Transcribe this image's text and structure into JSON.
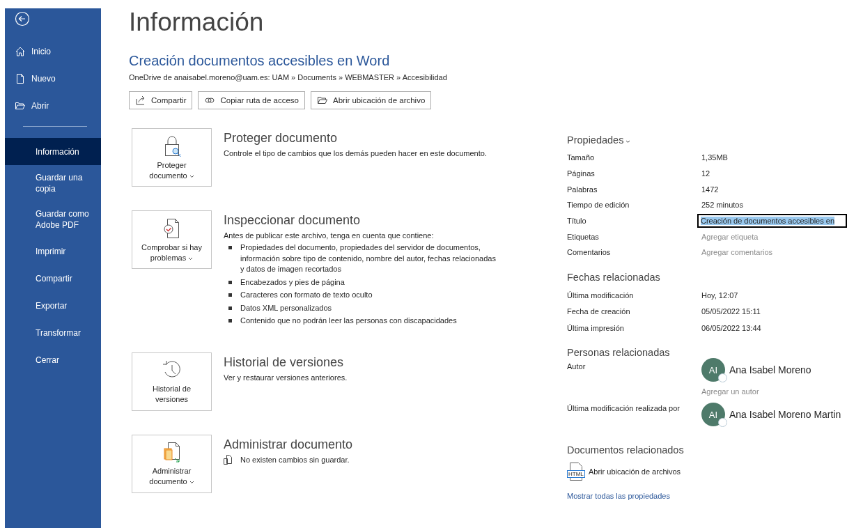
{
  "sidebar": {
    "items": [
      {
        "label": "Inicio",
        "kind": "icon",
        "selected": false
      },
      {
        "label": "Nuevo",
        "kind": "icon",
        "selected": false
      },
      {
        "label": "Abrir",
        "kind": "icon",
        "selected": false
      },
      {
        "kind": "divider"
      },
      {
        "label": "Información",
        "kind": "plain",
        "selected": true
      },
      {
        "label": "Guardar una copia",
        "kind": "plain",
        "selected": false
      },
      {
        "label": "Guardar como Adobe PDF",
        "kind": "plain",
        "selected": false
      },
      {
        "label": "Imprimir",
        "kind": "plain",
        "selected": false
      },
      {
        "label": "Compartir",
        "kind": "plain",
        "selected": false
      },
      {
        "label": "Exportar",
        "kind": "plain",
        "selected": false
      },
      {
        "label": "Transformar",
        "kind": "plain",
        "selected": false
      },
      {
        "label": "Cerrar",
        "kind": "plain",
        "selected": false
      }
    ]
  },
  "page_title": "Información",
  "document": {
    "title": "Creación documentos accesibles en Word",
    "path": "OneDrive de anaisabel.moreno@uam.es: UAM » Documents » WEBMASTER » Accesibilidad"
  },
  "actions": [
    {
      "label": "Compartir"
    },
    {
      "label": "Copiar ruta de acceso"
    },
    {
      "label": "Abrir ubicación de archivo"
    }
  ],
  "sections": [
    {
      "button": "Proteger documento",
      "dropdown": true,
      "title": "Proteger documento",
      "description": "Controle el tipo de cambios que los demás pueden hacer en este documento."
    },
    {
      "button": "Comprobar si hay problemas",
      "dropdown": true,
      "title": "Inspeccionar documento",
      "description": "Antes de publicar este archivo, tenga en cuenta que contiene:",
      "bullets": [
        "Propiedades del documento, propiedades del servidor de documentos, información sobre tipo de contenido, nombre del autor, fechas relacionadas y datos de imagen recortados",
        "Encabezados y pies de página",
        "Caracteres con formato de texto oculto",
        "Datos XML personalizados",
        "Contenido que no podrán leer las personas con discapacidades"
      ]
    },
    {
      "button": "Historial de versiones",
      "dropdown": false,
      "title": "Historial de versiones",
      "description": "Ver y restaurar versiones anteriores."
    },
    {
      "button": "Administrar documento",
      "dropdown": true,
      "title": "Administrar documento",
      "note": "No existen cambios sin guardar."
    }
  ],
  "properties": {
    "heading": "Propiedades",
    "rows": [
      {
        "label": "Tamaño",
        "value": "1,35MB",
        "kind": "text"
      },
      {
        "label": "Páginas",
        "value": "12",
        "kind": "text"
      },
      {
        "label": "Palabras",
        "value": "1472",
        "kind": "text"
      },
      {
        "label": "Tiempo de edición",
        "value": "252 minutos",
        "kind": "text"
      },
      {
        "label": "Título",
        "value": "Creación de documentos accesibles en",
        "kind": "field"
      },
      {
        "label": "Etiquetas",
        "placeholder": "Agregar etiqueta",
        "kind": "hint"
      },
      {
        "label": "Comentarios",
        "placeholder": "Agregar comentarios",
        "kind": "hint"
      }
    ]
  },
  "dates": {
    "heading": "Fechas relacionadas",
    "rows": [
      {
        "label": "Última modificación",
        "value": "Hoy, 12:07"
      },
      {
        "label": "Fecha de creación",
        "value": "05/05/2022 15:11"
      },
      {
        "label": "Última impresión",
        "value": "06/05/2022 13:44"
      }
    ]
  },
  "people": {
    "heading": "Personas relacionadas",
    "rows": [
      {
        "label": "Autor",
        "initials": "AI",
        "name": "Ana Isabel Moreno",
        "add": "Agregar un autor"
      },
      {
        "label": "Última modificación realizada por",
        "initials": "AI",
        "name": "Ana Isabel Moreno Martin"
      }
    ]
  },
  "related": {
    "heading": "Documentos relacionados",
    "item": "Abrir ubicación de archivos",
    "badge": "HTML"
  },
  "show_all": "Mostrar todas las propiedades"
}
